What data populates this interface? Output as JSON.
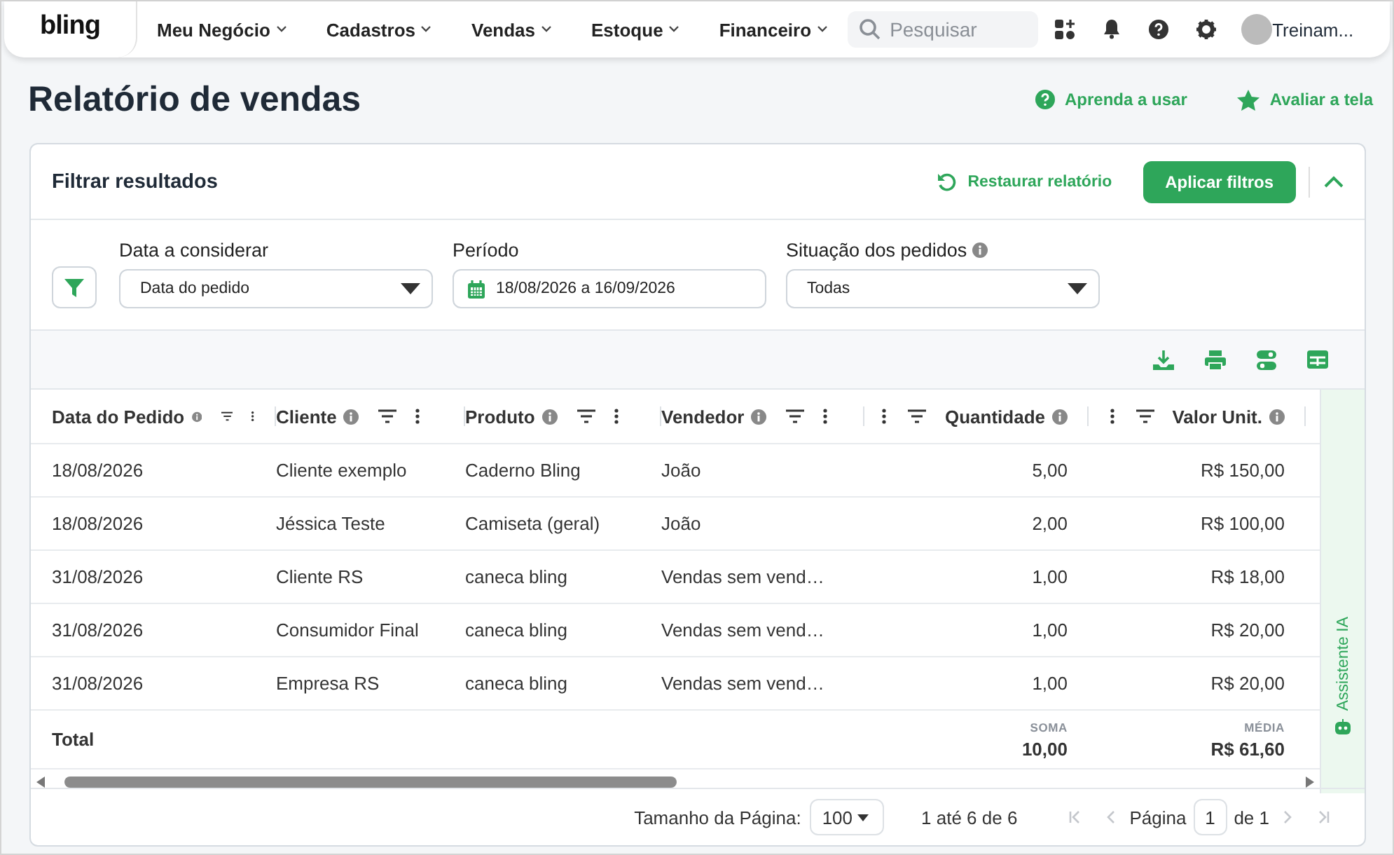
{
  "nav": {
    "logo": "bling",
    "menu": [
      {
        "label": "Meu Negócio"
      },
      {
        "label": "Cadastros"
      },
      {
        "label": "Vendas"
      },
      {
        "label": "Estoque"
      },
      {
        "label": "Financeiro"
      }
    ],
    "search": {
      "placeholder": "Pesquisar"
    },
    "user": "Treinam..."
  },
  "page": {
    "title": "Relatório de vendas",
    "actions": [
      {
        "label": "Aprenda a usar",
        "kind": "help"
      },
      {
        "label": "Avaliar a tela",
        "kind": "star"
      }
    ]
  },
  "filters": {
    "title": "Filtrar resultados",
    "restore": "Restaurar relatório",
    "apply": "Aplicar filtros",
    "expanded": true,
    "fields": [
      {
        "label": "Data a considerar",
        "kind": "select",
        "value": "Data do pedido",
        "info": false
      },
      {
        "label": "Período",
        "kind": "date",
        "value": "18/08/2026 a 16/09/2026",
        "info": false
      },
      {
        "label": "Situação dos pedidos",
        "kind": "select",
        "value": "Todas",
        "info": true
      }
    ]
  },
  "table": {
    "columns": [
      {
        "label": "Data do Pedido",
        "kind": "text"
      },
      {
        "label": "Cliente",
        "kind": "text"
      },
      {
        "label": "Produto",
        "kind": "text"
      },
      {
        "label": "Vendedor",
        "kind": "text"
      },
      {
        "label": "Quantidade",
        "kind": "number",
        "total": {
          "caption": "SOMA",
          "value": "10,00"
        }
      },
      {
        "label": "Valor Unit.",
        "kind": "number",
        "total": {
          "caption": "MÉDIA",
          "value": "R$ 61,60"
        }
      }
    ],
    "rows": [
      [
        "18/08/2026",
        "Cliente exemplo",
        "Caderno Bling",
        "João",
        "5,00",
        "R$ 150,00"
      ],
      [
        "18/08/2026",
        "Jéssica Teste",
        "Camiseta (geral)",
        "João",
        "2,00",
        "R$ 100,00"
      ],
      [
        "31/08/2026",
        "Cliente RS",
        "caneca bling",
        "Vendas sem vend…",
        "1,00",
        "R$ 18,00"
      ],
      [
        "31/08/2026",
        "Consumidor Final",
        "caneca bling",
        "Vendas sem vend…",
        "1,00",
        "R$ 20,00"
      ],
      [
        "31/08/2026",
        "Empresa RS",
        "caneca bling",
        "Vendas sem vend…",
        "1,00",
        "R$ 20,00"
      ]
    ],
    "total_label": "Total"
  },
  "side_panel": {
    "label": "Assistente IA"
  },
  "pagination": {
    "page_size_label": "Tamanho da Página:",
    "page_size": "100",
    "range": "1 até 6 de 6",
    "page_label": "Página",
    "page": "1",
    "of": "de 1"
  }
}
